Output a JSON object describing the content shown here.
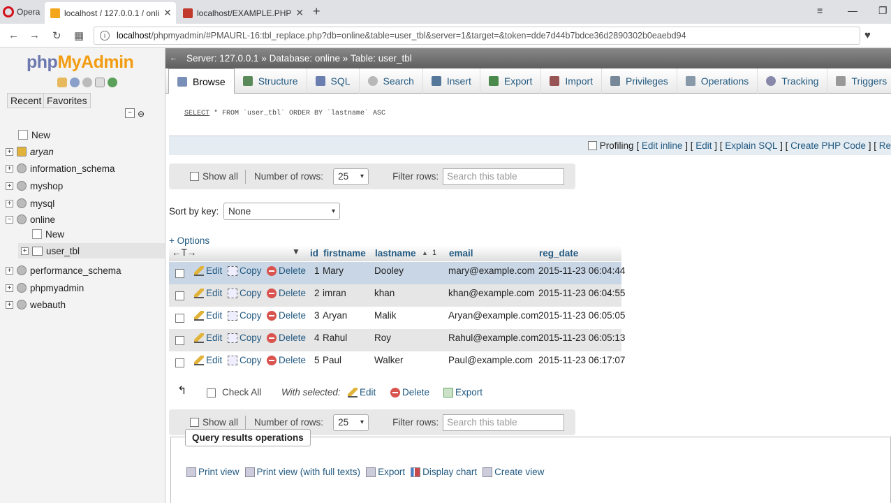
{
  "browser": {
    "brand": "Opera",
    "tabs": [
      {
        "title": "localhost / 127.0.0.1 / onli"
      },
      {
        "title": "localhost/EXAMPLE.PHP"
      }
    ],
    "url_host": "localhost",
    "url_rest": "/phpmyadmin/#PMAURL-16:tbl_replace.php?db=online&table=user_tbl&server=1&target=&token=dde7d44b7bdce36d2890302b0eaebd94"
  },
  "sidebar": {
    "logo_php": "php",
    "logo_myadmin": "MyAdmin",
    "recent": "Recent",
    "favorites": "Favorites",
    "tree": [
      {
        "label": "New"
      },
      {
        "label": "aryan"
      },
      {
        "label": "information_schema"
      },
      {
        "label": "myshop"
      },
      {
        "label": "mysql"
      },
      {
        "label": "online"
      },
      {
        "label": "New"
      },
      {
        "label": "user_tbl"
      },
      {
        "label": "performance_schema"
      },
      {
        "label": "phpmyadmin"
      },
      {
        "label": "webauth"
      }
    ]
  },
  "breadcrumb": {
    "server": "Server: 127.0.0.1",
    "database": "Database: online",
    "table": "Table: user_tbl",
    "sep": "»"
  },
  "tabs": [
    {
      "label": "Browse",
      "color": "#7a8fb8"
    },
    {
      "label": "Structure",
      "color": "#5a8a5a"
    },
    {
      "label": "SQL",
      "color": "#6a7fb0"
    },
    {
      "label": "Search",
      "color": "#b8b8b8"
    },
    {
      "label": "Insert",
      "color": "#557799"
    },
    {
      "label": "Export",
      "color": "#4a8a4a"
    },
    {
      "label": "Import",
      "color": "#995555"
    },
    {
      "label": "Privileges",
      "color": "#778899"
    },
    {
      "label": "Operations",
      "color": "#8899aa"
    },
    {
      "label": "Tracking",
      "color": "#8888aa"
    },
    {
      "label": "Triggers",
      "color": "#999999"
    }
  ],
  "sql": {
    "select": "SELECT",
    "rest": " * FROM `user_tbl` ORDER BY `lastname` ASC"
  },
  "profiling": {
    "label": "Profiling",
    "b1": "[",
    "edit_inline": "Edit inline",
    "b2": "] [",
    "edit": "Edit",
    "b3": "] [",
    "explain": "Explain SQL",
    "b4": "] [",
    "create_php": "Create PHP Code",
    "b5": "] [",
    "refresh": "Re"
  },
  "nav": {
    "show_all": "Show all",
    "rows_label": "Number of rows:",
    "rows_value": "25",
    "filter_label": "Filter rows:",
    "filter_placeholder": "Search this table"
  },
  "sortkey": {
    "label": "Sort by key:",
    "value": "None"
  },
  "options_link": "+ Options",
  "table": {
    "arrows": "←T→",
    "columns": [
      "id",
      "firstname",
      "lastname",
      "email",
      "reg_date"
    ],
    "sort_marker": "1",
    "action_edit": "Edit",
    "action_copy": "Copy",
    "action_delete": "Delete",
    "rows": [
      {
        "id": "1",
        "firstname": "Mary",
        "lastname": "Dooley",
        "email": "mary@example.com",
        "reg_date": "2015-11-23 06:04:44"
      },
      {
        "id": "2",
        "firstname": "imran",
        "lastname": "khan",
        "email": "khan@example.com",
        "reg_date": "2015-11-23 06:04:55"
      },
      {
        "id": "3",
        "firstname": "Aryan",
        "lastname": "Malik",
        "email": "Aryan@example.com",
        "reg_date": "2015-11-23 06:05:05"
      },
      {
        "id": "4",
        "firstname": "Rahul",
        "lastname": "Roy",
        "email": "Rahul@example.com",
        "reg_date": "2015-11-23 06:05:13"
      },
      {
        "id": "5",
        "firstname": "Paul",
        "lastname": "Walker",
        "email": "Paul@example.com",
        "reg_date": "2015-11-23 06:17:07"
      }
    ]
  },
  "bulk": {
    "check_all": "Check All",
    "with_selected": "With selected:",
    "edit": "Edit",
    "delete": "Delete",
    "export": "Export"
  },
  "qro": {
    "legend": "Query results operations",
    "items": [
      "Print view",
      "Print view (with full texts)",
      "Export",
      "Display chart",
      "Create view"
    ]
  }
}
